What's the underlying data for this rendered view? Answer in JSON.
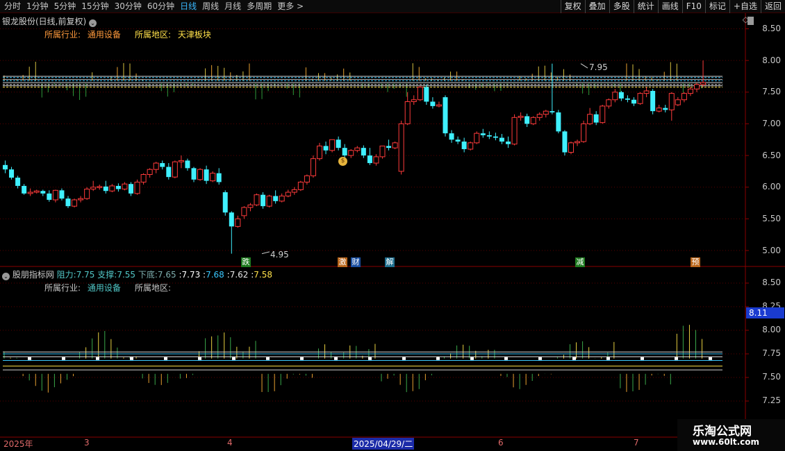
{
  "toolbar": {
    "periods": [
      "分时",
      "1分钟",
      "5分钟",
      "15分钟",
      "30分钟",
      "60分钟",
      "日线",
      "周线",
      "月线",
      "多周期",
      "更多 >"
    ],
    "active_period": "日线",
    "actions": [
      "复权",
      "叠加",
      "多股",
      "统计",
      "画线",
      "F10",
      "标记",
      "+自选",
      "返回"
    ]
  },
  "stock": {
    "title": "银龙股份(日线,前复权)",
    "industry_label": "所属行业:",
    "industry_value": "通用设备",
    "region_label": "所属地区:",
    "region_value": "天津板块"
  },
  "indicator": {
    "name": "股朋指标网",
    "resist_label": "阻力:",
    "resist_value": "7.75",
    "support_label": "支撑:",
    "support_value": "7.55",
    "bottom_label": "下底:",
    "bottom_value": "7.65",
    "v1": "7.73",
    "v2": "7.68",
    "v3": "7.62",
    "v4": "7.58",
    "industry_label": "所属行业:",
    "industry_value": "通用设备",
    "region_label": "所属地区:"
  },
  "annotations": {
    "high": "7.95",
    "low": "4.95"
  },
  "event_tags": [
    {
      "text": "跌",
      "color": "#1f7a1f"
    },
    {
      "text": "激",
      "color": "#b8651a"
    },
    {
      "text": "财",
      "color": "#1b4fa0"
    },
    {
      "text": "解",
      "color": "#1f6f8f"
    },
    {
      "text": "减",
      "color": "#1f7a1f"
    },
    {
      "text": "预",
      "color": "#b8651a"
    }
  ],
  "price_axis": [
    "8.50",
    "8.00",
    "7.50",
    "7.00",
    "6.50",
    "6.00",
    "5.50",
    "5.00"
  ],
  "ind_axis": [
    "8.50",
    "8.25",
    "8.00",
    "7.75",
    "7.50",
    "7.25"
  ],
  "ind_current": "8.11",
  "date_axis": {
    "labels": [
      "2025年",
      "3",
      "4",
      "6",
      "7"
    ],
    "current": "2025/04/29/二"
  },
  "watermark": {
    "line1": "乐淘公式网",
    "line2": "www.60lt.com"
  },
  "colors": {
    "up": "#ff3b3b",
    "down": "#3ff0ff",
    "grid": "#5a0000",
    "bg": "#000000"
  },
  "chart_data": {
    "type": "candlestick",
    "ylim": [
      4.85,
      8.6
    ],
    "indicator_ylim": [
      7.1,
      8.6
    ],
    "candles": [
      [
        6.35,
        6.42,
        6.28,
        6.22
      ],
      [
        6.28,
        6.32,
        6.15,
        6.12
      ],
      [
        6.15,
        6.18,
        6.02,
        5.98
      ],
      [
        6.02,
        6.05,
        5.9,
        5.88
      ],
      [
        5.9,
        5.98,
        5.92,
        5.86
      ],
      [
        5.92,
        5.96,
        5.94,
        5.9
      ],
      [
        5.94,
        5.96,
        5.9,
        5.86
      ],
      [
        5.9,
        5.95,
        5.8,
        5.77
      ],
      [
        5.8,
        5.96,
        5.95,
        5.76
      ],
      [
        5.95,
        5.98,
        5.82,
        5.79
      ],
      [
        5.82,
        5.86,
        5.7,
        5.67
      ],
      [
        5.7,
        5.82,
        5.8,
        5.68
      ],
      [
        5.8,
        5.86,
        5.82,
        5.76
      ],
      [
        5.82,
        6.0,
        5.97,
        5.8
      ],
      [
        5.97,
        6.1,
        6.0,
        5.94
      ],
      [
        6.0,
        6.04,
        6.01,
        5.96
      ],
      [
        6.01,
        6.1,
        5.94,
        5.9
      ],
      [
        5.94,
        6.05,
        6.02,
        5.92
      ],
      [
        6.02,
        6.06,
        5.97,
        5.93
      ],
      [
        5.97,
        6.08,
        6.05,
        5.95
      ],
      [
        6.05,
        6.08,
        5.9,
        5.86
      ],
      [
        5.9,
        6.12,
        6.08,
        5.88
      ],
      [
        6.08,
        6.22,
        6.2,
        6.04
      ],
      [
        6.2,
        6.3,
        6.28,
        6.15
      ],
      [
        6.28,
        6.4,
        6.38,
        6.22
      ],
      [
        6.38,
        6.42,
        6.32,
        6.28
      ],
      [
        6.32,
        6.38,
        6.16,
        6.12
      ],
      [
        6.16,
        6.42,
        6.4,
        6.14
      ],
      [
        6.4,
        6.5,
        6.42,
        6.3
      ],
      [
        6.42,
        6.45,
        6.3,
        6.26
      ],
      [
        6.3,
        6.32,
        6.12,
        6.08
      ],
      [
        6.12,
        6.3,
        6.28,
        6.1
      ],
      [
        6.28,
        6.34,
        6.1,
        6.05
      ],
      [
        6.1,
        6.25,
        6.22,
        6.08
      ],
      [
        6.22,
        6.3,
        6.08,
        6.04
      ],
      [
        5.92,
        5.95,
        5.6,
        5.55
      ],
      [
        5.6,
        5.62,
        5.38,
        4.95
      ],
      [
        5.38,
        5.55,
        5.5,
        5.36
      ],
      [
        5.55,
        5.7,
        5.68,
        5.5
      ],
      [
        5.68,
        5.75,
        5.72,
        5.62
      ],
      [
        5.72,
        5.9,
        5.88,
        5.7
      ],
      [
        5.88,
        5.92,
        5.7,
        5.66
      ],
      [
        5.7,
        5.88,
        5.86,
        5.68
      ],
      [
        5.86,
        5.95,
        5.78,
        5.74
      ],
      [
        5.78,
        5.9,
        5.86,
        5.76
      ],
      [
        5.86,
        5.96,
        5.92,
        5.84
      ],
      [
        5.92,
        6.0,
        5.96,
        5.88
      ],
      [
        5.96,
        6.1,
        6.08,
        5.94
      ],
      [
        6.08,
        6.2,
        6.18,
        6.04
      ],
      [
        6.18,
        6.5,
        6.45,
        6.15
      ],
      [
        6.45,
        6.7,
        6.65,
        6.42
      ],
      [
        6.65,
        6.72,
        6.58,
        6.52
      ],
      [
        6.58,
        6.72,
        6.75,
        6.55
      ],
      [
        6.75,
        6.8,
        6.62,
        6.58
      ],
      [
        6.62,
        6.68,
        6.5,
        6.45
      ],
      [
        6.5,
        6.6,
        6.58,
        6.46
      ],
      [
        6.58,
        6.65,
        6.62,
        6.55
      ],
      [
        6.62,
        6.66,
        6.5,
        6.46
      ],
      [
        6.5,
        6.62,
        6.38,
        6.35
      ],
      [
        6.38,
        6.52,
        6.48,
        6.34
      ],
      [
        6.48,
        6.6,
        6.65,
        6.45
      ],
      [
        6.65,
        6.75,
        6.62,
        6.58
      ],
      [
        6.62,
        6.72,
        6.7,
        6.6
      ],
      [
        6.25,
        7.05,
        7.0,
        6.2
      ],
      [
        7.0,
        7.5,
        7.35,
        6.98
      ],
      [
        7.35,
        7.45,
        7.38,
        7.3
      ],
      [
        7.38,
        7.6,
        7.58,
        7.36
      ],
      [
        7.58,
        7.62,
        7.35,
        7.3
      ],
      [
        7.35,
        7.42,
        7.28,
        7.24
      ],
      [
        7.28,
        7.35,
        7.3,
        7.26
      ],
      [
        7.42,
        7.45,
        6.85,
        6.8
      ],
      [
        6.85,
        6.9,
        6.75,
        6.7
      ],
      [
        6.75,
        6.8,
        6.72,
        6.68
      ],
      [
        6.72,
        6.78,
        6.6,
        6.55
      ],
      [
        6.6,
        6.72,
        6.7,
        6.58
      ],
      [
        6.7,
        6.88,
        6.85,
        6.68
      ],
      [
        6.85,
        6.92,
        6.82,
        6.78
      ],
      [
        6.82,
        6.88,
        6.8,
        6.76
      ],
      [
        6.8,
        6.86,
        6.78,
        6.74
      ],
      [
        6.78,
        6.84,
        6.72,
        6.68
      ],
      [
        6.72,
        6.8,
        6.68,
        6.62
      ],
      [
        6.68,
        7.15,
        7.1,
        6.66
      ],
      [
        7.1,
        7.18,
        7.12,
        7.05
      ],
      [
        7.12,
        7.16,
        7.0,
        6.95
      ],
      [
        7.0,
        7.12,
        7.1,
        6.98
      ],
      [
        7.1,
        7.18,
        7.15,
        7.05
      ],
      [
        7.15,
        7.22,
        7.2,
        7.1
      ],
      [
        7.2,
        7.95,
        7.18,
        7.15
      ],
      [
        7.18,
        7.22,
        6.88,
        6.85
      ],
      [
        6.88,
        6.9,
        6.55,
        6.5
      ],
      [
        6.55,
        6.72,
        6.7,
        6.52
      ],
      [
        6.7,
        6.75,
        6.72,
        6.65
      ],
      [
        6.72,
        7.05,
        7.0,
        6.7
      ],
      [
        7.0,
        7.25,
        7.15,
        6.98
      ],
      [
        7.15,
        7.2,
        7.02,
        6.98
      ],
      [
        7.02,
        7.3,
        7.28,
        7.0
      ],
      [
        7.28,
        7.4,
        7.38,
        7.24
      ],
      [
        7.38,
        7.55,
        7.5,
        7.34
      ],
      [
        7.5,
        7.52,
        7.4,
        7.36
      ],
      [
        7.4,
        7.45,
        7.38,
        7.34
      ],
      [
        7.38,
        7.42,
        7.32,
        7.28
      ],
      [
        7.32,
        7.5,
        7.48,
        7.3
      ],
      [
        7.48,
        7.58,
        7.52,
        7.42
      ],
      [
        7.52,
        7.55,
        7.2,
        7.15
      ],
      [
        7.2,
        7.3,
        7.25,
        7.18
      ],
      [
        7.25,
        7.3,
        7.22,
        7.18
      ],
      [
        7.22,
        7.5,
        7.48,
        7.05
      ],
      [
        7.3,
        7.42,
        7.38,
        7.28
      ],
      [
        7.38,
        7.5,
        7.48,
        7.34
      ],
      [
        7.48,
        7.58,
        7.55,
        7.44
      ],
      [
        7.55,
        7.65,
        7.62,
        7.5
      ],
      [
        7.62,
        8.0,
        7.65,
        7.58
      ]
    ]
  }
}
